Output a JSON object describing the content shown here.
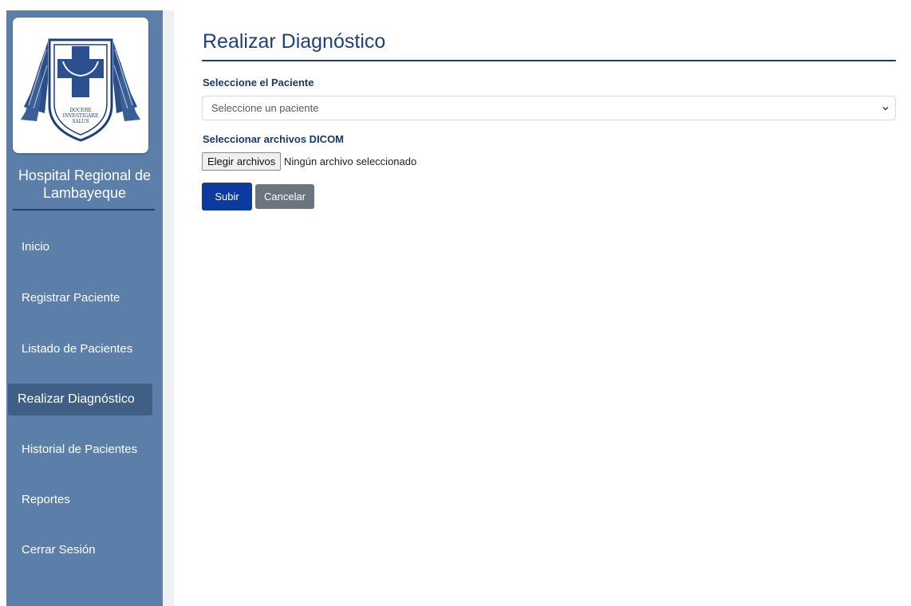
{
  "sidebar": {
    "hospital_name_line1": "Hospital Regional de",
    "hospital_name_line2": "Lambayeque",
    "logo_text": [
      "DOCERE",
      "INVESTIGARE",
      "SALUS"
    ],
    "items": [
      {
        "label": "Inicio",
        "active": false
      },
      {
        "label": "Registrar Paciente",
        "active": false
      },
      {
        "label": "Listado de Pacientes",
        "active": false
      },
      {
        "label": "Realizar Diagnóstico",
        "active": true
      },
      {
        "label": "Historial de Pacientes",
        "active": false
      },
      {
        "label": "Reportes",
        "active": false
      },
      {
        "label": "Cerrar Sesión",
        "active": false
      }
    ]
  },
  "main": {
    "title": "Realizar Diagnóstico",
    "patient_label": "Seleccione el Paciente",
    "patient_select_value": "Seleccione un paciente",
    "dicom_label": "Seleccionar archivos DICOM",
    "file_button_label": "Elegir archivos",
    "file_status": "Ningún archivo seleccionado",
    "submit_label": "Subir",
    "cancel_label": "Cancelar"
  },
  "colors": {
    "sidebar_bg": "#5b7fa8",
    "sidebar_active": "#3f5f86",
    "title": "#1f3f7a",
    "primary_button": "#0b3aa0",
    "secondary_button": "#6c757d"
  },
  "icons": {
    "logo": "hospital-crest-logo",
    "select_chevron": "chevron-down-icon"
  }
}
